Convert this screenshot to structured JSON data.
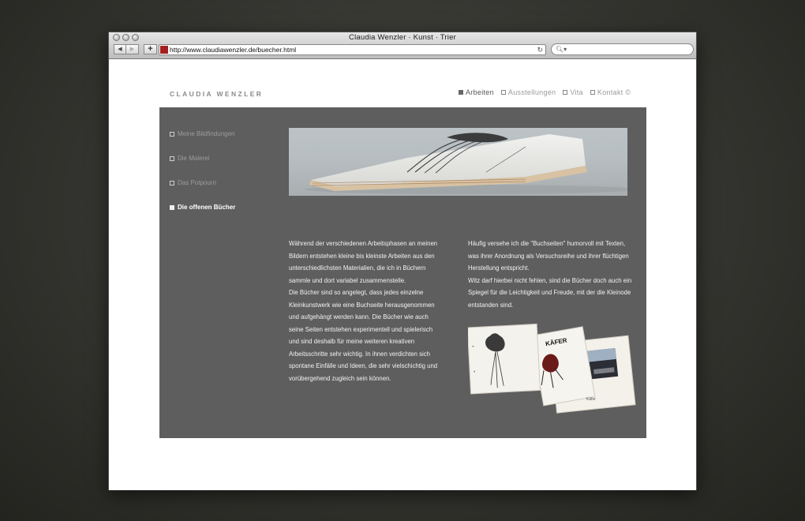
{
  "window": {
    "title": "Claudia Wenzler · Kunst · Trier",
    "url": "http://www.claudiawenzler.de/buecher.html",
    "search_placeholder": ""
  },
  "site": {
    "brand": "CLAUDIA WENZLER",
    "topnav": [
      {
        "label": "Arbeiten",
        "active": true
      },
      {
        "label": "Ausstellungen",
        "active": false
      },
      {
        "label": "Vita",
        "active": false
      },
      {
        "label": "Kontakt ©",
        "active": false
      }
    ],
    "sidenav": [
      {
        "label": "Meine Bildfindungen",
        "active": false
      },
      {
        "label": "Die Malerei",
        "active": false
      },
      {
        "label": "Das Potpourri",
        "active": false
      },
      {
        "label": "Die offenen Bücher",
        "active": true
      }
    ],
    "col1": [
      "Während der verschiedenen Arbeitsphasen an meinen",
      "Bildern entstehen kleine bis kleinste Arbeiten aus den",
      "unterschiedlichsten Materialien, die ich in Büchern",
      "sammle und dort variabel zusammenstelle.",
      "Die Bücher sind so angelegt, dass jedes einzelne",
      "Kleinkunstwerk wie eine Buchseite herausgenommen",
      "und aufgehängt werden kann. Die Bücher wie auch",
      "seine Seiten entstehen experimentell und spielerisch",
      "und sind deshalb für meine weiteren kreativen",
      "Arbeitsschritte sehr wichtig. In ihnen verdichten sich",
      "spontane Einfälle und Ideen, die sehr vielschichtig und",
      "vorübergehend zugleich sein können."
    ],
    "col2": [
      "Häufig versehe ich die \"Buchseiten\" humorvoll mit Texten,",
      "was ihrer Anordnung als Versuchsreihe und ihrer flüchtigen",
      "Herstellung entspricht.",
      "Witz darf hierbei nicht fehlen, sind die Bücher doch auch ein",
      "Spiegel für die Leichtigkeit und Freude, mit der die Kleinode",
      "entstanden sind."
    ],
    "book_text_1": "KÄFER",
    "book_text_2": "Käfer"
  }
}
